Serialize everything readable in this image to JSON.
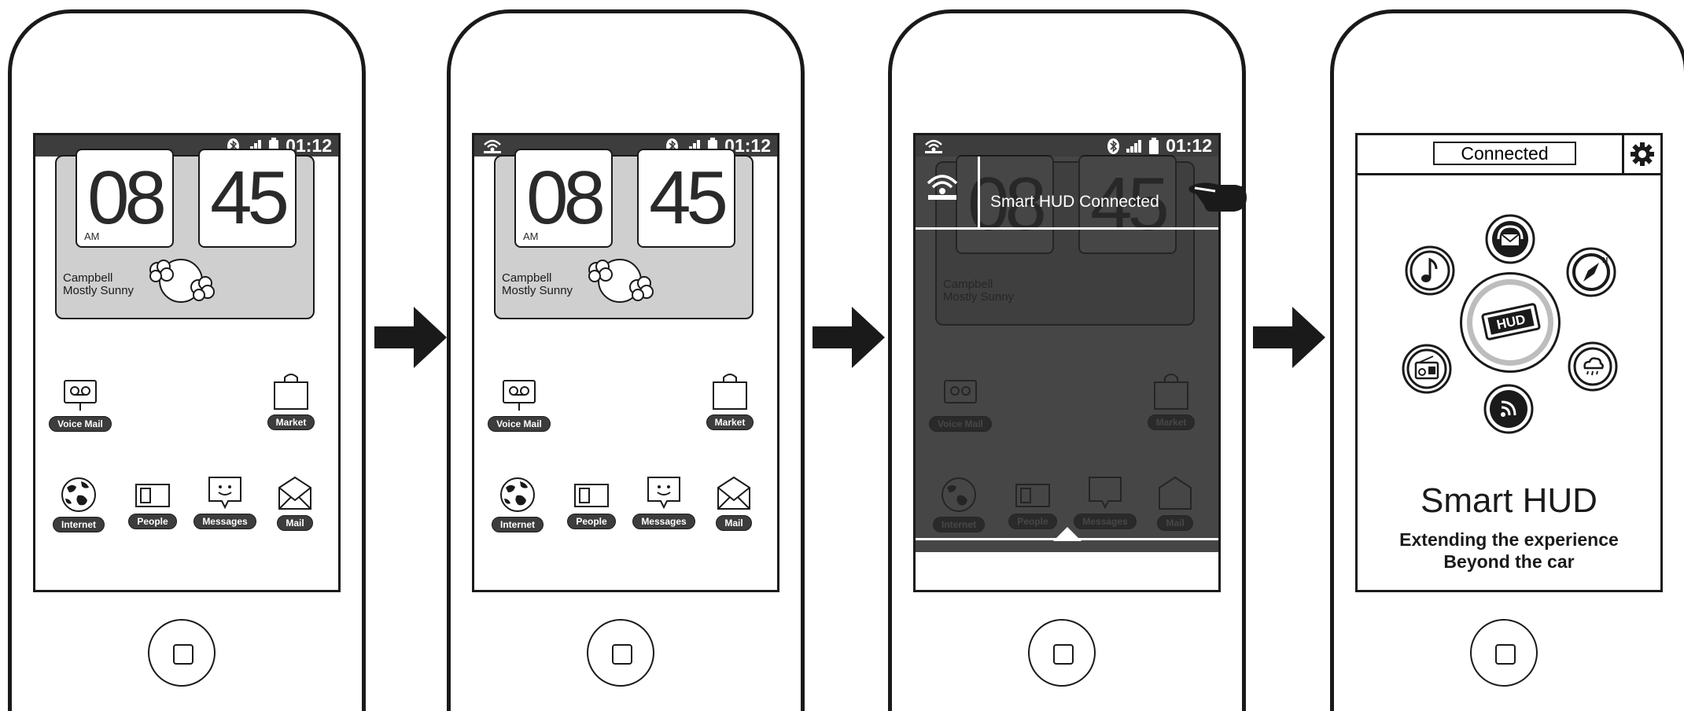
{
  "status": {
    "time": "01:12"
  },
  "widget": {
    "hour": "08",
    "minute": "45",
    "ampm": "AM",
    "city": "Campbell",
    "condition": "Mostly Sunny"
  },
  "apps": {
    "voice_mail": "Voice Mail",
    "market": "Market",
    "internet": "Internet",
    "people": "People",
    "messages": "Messages",
    "mail": "Mail"
  },
  "notification": {
    "text": "Smart HUD Connected"
  },
  "hud_app": {
    "connected_label": "Connected",
    "title": "Smart HUD",
    "subtitle_line1": "Extending the experience",
    "subtitle_line2": "Beyond the car",
    "center_icon": "hud-icon",
    "menu_icons": [
      "headset-mail-icon",
      "compass-icon",
      "weather-icon",
      "rss-icon",
      "radio-icon",
      "music-icon"
    ],
    "settings_icon": "gear-icon"
  },
  "colors": {
    "statusbar": "#3d3d3d",
    "widget_bg": "#cfcfcf",
    "overlay": "#282828",
    "outline": "#1a1a1a"
  }
}
